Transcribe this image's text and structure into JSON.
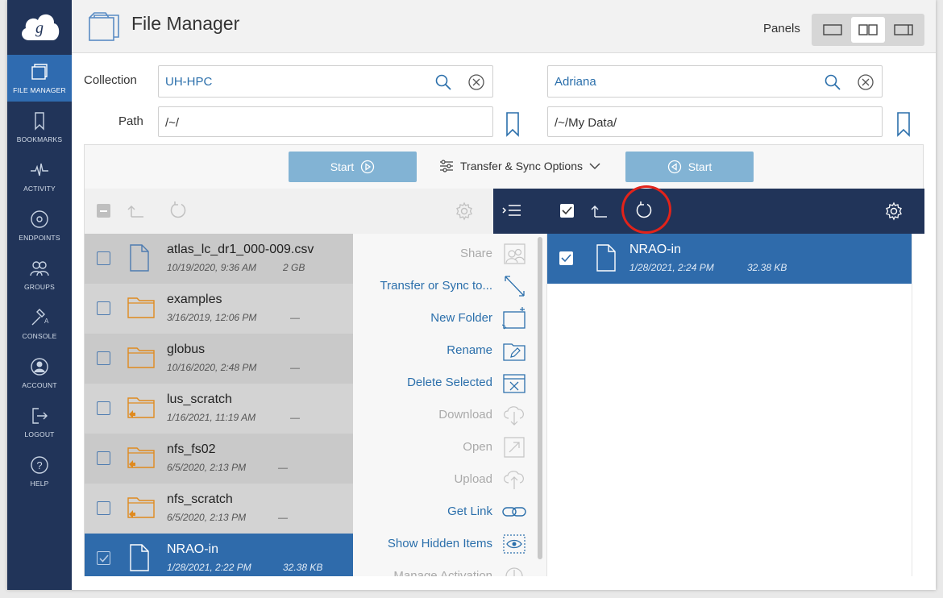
{
  "nav": {
    "items": [
      {
        "label": "FILE MANAGER",
        "icon": "file-manager-icon",
        "active": true
      },
      {
        "label": "BOOKMARKS",
        "icon": "bookmark-icon"
      },
      {
        "label": "ACTIVITY",
        "icon": "activity-icon"
      },
      {
        "label": "ENDPOINTS",
        "icon": "endpoints-icon"
      },
      {
        "label": "GROUPS",
        "icon": "groups-icon"
      },
      {
        "label": "CONSOLE",
        "icon": "console-icon"
      },
      {
        "label": "ACCOUNT",
        "icon": "account-icon"
      },
      {
        "label": "LOGOUT",
        "icon": "logout-icon"
      },
      {
        "label": "HELP",
        "icon": "help-icon"
      }
    ]
  },
  "header": {
    "title": "File Manager",
    "panels_label": "Panels"
  },
  "left": {
    "collection_label": "Collection",
    "collection_value": "UH-HPC",
    "path_label": "Path",
    "path_value": "/~/"
  },
  "right": {
    "collection_value": "Adriana",
    "path_value": "/~/My Data/"
  },
  "transfer": {
    "start_label": "Start",
    "start_right_label": "Start",
    "options_label": "Transfer & Sync Options"
  },
  "left_files": [
    {
      "name": "atlas_lc_dr1_000-009.csv",
      "date": "10/19/2020, 9:36 AM",
      "size": "2 GB",
      "type": "file"
    },
    {
      "name": "examples",
      "date": "3/16/2019, 12:06 PM",
      "size": "—",
      "type": "folder"
    },
    {
      "name": "globus",
      "date": "10/16/2020, 2:48 PM",
      "size": "—",
      "type": "folder"
    },
    {
      "name": "lus_scratch",
      "date": "1/16/2021, 11:19 AM",
      "size": "—",
      "type": "link-folder"
    },
    {
      "name": "nfs_fs02",
      "date": "6/5/2020, 2:13 PM",
      "size": "—",
      "type": "link-folder"
    },
    {
      "name": "nfs_scratch",
      "date": "6/5/2020, 2:13 PM",
      "size": "—",
      "type": "link-folder"
    },
    {
      "name": "NRAO-in",
      "date": "1/28/2021, 2:22 PM",
      "size": "32.38 KB",
      "type": "file",
      "selected": true
    }
  ],
  "actions": [
    {
      "label": "Share",
      "enabled": false
    },
    {
      "label": "Transfer or Sync to...",
      "enabled": true
    },
    {
      "label": "New Folder",
      "enabled": true
    },
    {
      "label": "Rename",
      "enabled": true
    },
    {
      "label": "Delete Selected",
      "enabled": true
    },
    {
      "label": "Download",
      "enabled": false
    },
    {
      "label": "Open",
      "enabled": false
    },
    {
      "label": "Upload",
      "enabled": false
    },
    {
      "label": "Get Link",
      "enabled": true
    },
    {
      "label": "Show Hidden Items",
      "enabled": true
    },
    {
      "label": "Manage Activation",
      "enabled": false
    }
  ],
  "right_files": [
    {
      "name": "NRAO-in",
      "date": "1/28/2021, 2:24 PM",
      "size": "32.38 KB",
      "type": "file",
      "selected": true
    }
  ],
  "colors": {
    "nav_bg": "#213459",
    "accent": "#2f6bab",
    "start_btn": "#82b3d4",
    "highlight": "#e2231a",
    "folder": "#e08a1e"
  }
}
